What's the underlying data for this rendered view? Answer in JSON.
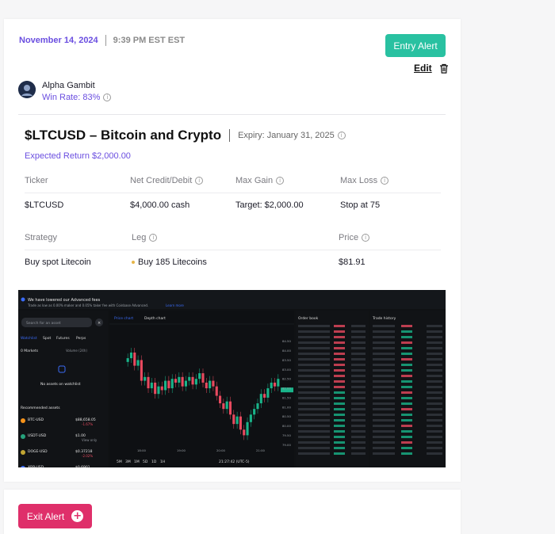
{
  "alert": {
    "date": "November 14, 2024",
    "time": "9:39 PM EST EST",
    "entry_button": "Entry Alert",
    "edit_label": "Edit"
  },
  "trader": {
    "name": "Alpha Gambit",
    "win_rate": "Win Rate: 83%"
  },
  "trade": {
    "title": "$LTCUSD – Bitcoin and Crypto",
    "expiry": "Expiry: January 31, 2025",
    "expected_return": "Expected Return $2,000.00",
    "headers1": {
      "ticker": "Ticker",
      "net": "Net Credit/Debit",
      "max_gain": "Max Gain",
      "max_loss": "Max Loss"
    },
    "values1": {
      "ticker": "$LTCUSD",
      "net": "$4,000.00 cash",
      "max_gain": "Target: $2,000.00",
      "max_loss": "Stop at 75"
    },
    "headers2": {
      "strategy": "Strategy",
      "leg": "Leg",
      "price": "Price"
    },
    "values2": {
      "strategy": "Buy spot Litecoin",
      "leg": "Buy 185 Litecoins",
      "price": "$81.91"
    }
  },
  "screenshot": {
    "banner": "We have lowered our Advanced fees",
    "banner_sub": "Trade as low as 0.00% maker and 0.05% taker fee with Coinbase Advanced.",
    "banner_link": "Learn more",
    "search_placeholder": "Search for an asset",
    "tabs": [
      "Watchlist",
      "Spot",
      "Futures",
      "Perps"
    ],
    "markets_label": "0 Markets",
    "volume_label": "Volume (24h)",
    "empty_title": "No assets on watchlist",
    "recommended": "Recommended assets",
    "assets": [
      {
        "name": "BTC-USD",
        "price": "$88,658.05",
        "change": "-1.67%"
      },
      {
        "name": "USDT-USD",
        "price": "$1.00",
        "change": "View only"
      },
      {
        "name": "DOGE-USD",
        "price": "$0.37218",
        "change": "-2.02%"
      },
      {
        "name": "XRP-USD",
        "price": "$0.6901",
        "change": ""
      }
    ],
    "chart_tabs": [
      "Price chart",
      "Depth chart"
    ],
    "order_book": "Order book",
    "trade_history": "Trade history",
    "timeframes": [
      "5M",
      "3M",
      "1M",
      "5D",
      "1D",
      "1H"
    ],
    "clock": "21:27:42 (UTC-5)",
    "price_ticks": [
      "84.50",
      "84.00",
      "83.50",
      "83.00",
      "82.50",
      "82.00",
      "81.50",
      "81.00",
      "80.50",
      "80.00",
      "79.50",
      "79.00"
    ],
    "time_ticks": [
      "18:00",
      "19:00",
      "20:00",
      "21:00"
    ],
    "colors": {
      "up": "#19b58a",
      "down": "#e84a5f",
      "bg": "#101214"
    }
  },
  "exit": {
    "button": "Exit Alert"
  }
}
